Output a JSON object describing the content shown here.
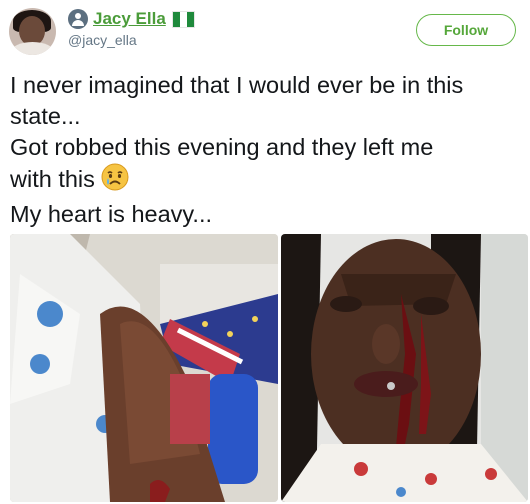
{
  "user": {
    "display_name": "Jacy Ella",
    "handle": "@jacy_ella",
    "flag_colors": [
      "#1f8a3c",
      "#ffffff",
      "#1f8a3c"
    ],
    "name_color": "#4b9c3a"
  },
  "follow_button": {
    "label": "Follow"
  },
  "tweet": {
    "lines": [
      "I never imagined that I would ever be in this",
      "state...",
      "Got robbed this evening and they left me",
      "with this",
      "My heart is heavy..."
    ],
    "emoji": "crying-face"
  }
}
